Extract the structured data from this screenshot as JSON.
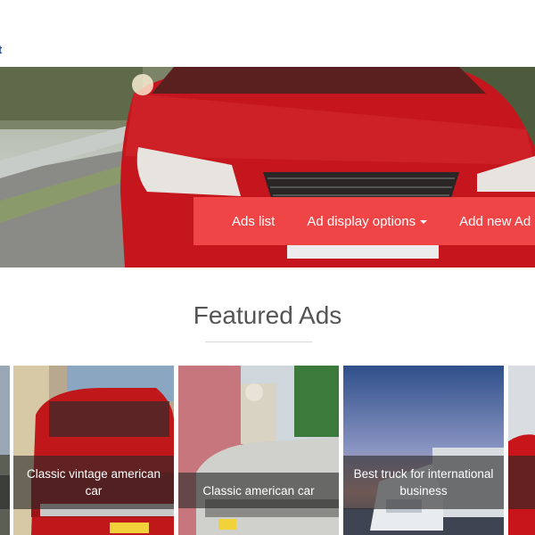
{
  "header": {
    "glyph": "t"
  },
  "nav": {
    "ads_list": "Ads list",
    "display_options": "Ad display options",
    "add_new": "Add new Ad"
  },
  "featured": {
    "title": "Featured Ads",
    "cards": [
      {
        "caption": ""
      },
      {
        "caption": "Classic vintage american car"
      },
      {
        "caption": "Classic american car"
      },
      {
        "caption": "Best truck for international business"
      },
      {
        "caption": ""
      }
    ]
  },
  "colors": {
    "accent": "#f04546",
    "title_text": "#555555"
  }
}
